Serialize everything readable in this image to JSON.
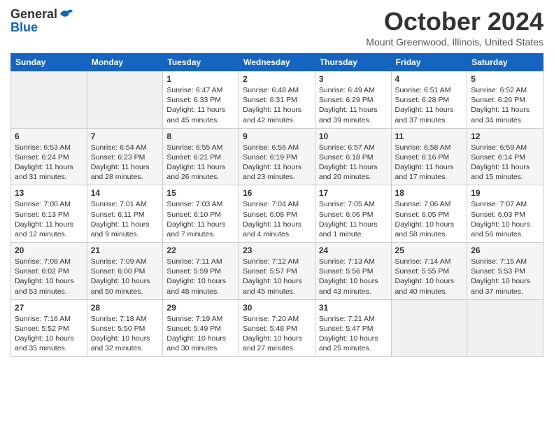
{
  "header": {
    "logo_general": "General",
    "logo_blue": "Blue",
    "title": "October 2024",
    "location": "Mount Greenwood, Illinois, United States"
  },
  "weekdays": [
    "Sunday",
    "Monday",
    "Tuesday",
    "Wednesday",
    "Thursday",
    "Friday",
    "Saturday"
  ],
  "weeks": [
    [
      {
        "day": "",
        "sunrise": "",
        "sunset": "",
        "daylight": ""
      },
      {
        "day": "",
        "sunrise": "",
        "sunset": "",
        "daylight": ""
      },
      {
        "day": "1",
        "sunrise": "Sunrise: 6:47 AM",
        "sunset": "Sunset: 6:33 PM",
        "daylight": "Daylight: 11 hours and 45 minutes."
      },
      {
        "day": "2",
        "sunrise": "Sunrise: 6:48 AM",
        "sunset": "Sunset: 6:31 PM",
        "daylight": "Daylight: 11 hours and 42 minutes."
      },
      {
        "day": "3",
        "sunrise": "Sunrise: 6:49 AM",
        "sunset": "Sunset: 6:29 PM",
        "daylight": "Daylight: 11 hours and 39 minutes."
      },
      {
        "day": "4",
        "sunrise": "Sunrise: 6:51 AM",
        "sunset": "Sunset: 6:28 PM",
        "daylight": "Daylight: 11 hours and 37 minutes."
      },
      {
        "day": "5",
        "sunrise": "Sunrise: 6:52 AM",
        "sunset": "Sunset: 6:26 PM",
        "daylight": "Daylight: 11 hours and 34 minutes."
      }
    ],
    [
      {
        "day": "6",
        "sunrise": "Sunrise: 6:53 AM",
        "sunset": "Sunset: 6:24 PM",
        "daylight": "Daylight: 11 hours and 31 minutes."
      },
      {
        "day": "7",
        "sunrise": "Sunrise: 6:54 AM",
        "sunset": "Sunset: 6:23 PM",
        "daylight": "Daylight: 11 hours and 28 minutes."
      },
      {
        "day": "8",
        "sunrise": "Sunrise: 6:55 AM",
        "sunset": "Sunset: 6:21 PM",
        "daylight": "Daylight: 11 hours and 26 minutes."
      },
      {
        "day": "9",
        "sunrise": "Sunrise: 6:56 AM",
        "sunset": "Sunset: 6:19 PM",
        "daylight": "Daylight: 11 hours and 23 minutes."
      },
      {
        "day": "10",
        "sunrise": "Sunrise: 6:57 AM",
        "sunset": "Sunset: 6:18 PM",
        "daylight": "Daylight: 11 hours and 20 minutes."
      },
      {
        "day": "11",
        "sunrise": "Sunrise: 6:58 AM",
        "sunset": "Sunset: 6:16 PM",
        "daylight": "Daylight: 11 hours and 17 minutes."
      },
      {
        "day": "12",
        "sunrise": "Sunrise: 6:59 AM",
        "sunset": "Sunset: 6:14 PM",
        "daylight": "Daylight: 11 hours and 15 minutes."
      }
    ],
    [
      {
        "day": "13",
        "sunrise": "Sunrise: 7:00 AM",
        "sunset": "Sunset: 6:13 PM",
        "daylight": "Daylight: 11 hours and 12 minutes."
      },
      {
        "day": "14",
        "sunrise": "Sunrise: 7:01 AM",
        "sunset": "Sunset: 6:11 PM",
        "daylight": "Daylight: 11 hours and 9 minutes."
      },
      {
        "day": "15",
        "sunrise": "Sunrise: 7:03 AM",
        "sunset": "Sunset: 6:10 PM",
        "daylight": "Daylight: 11 hours and 7 minutes."
      },
      {
        "day": "16",
        "sunrise": "Sunrise: 7:04 AM",
        "sunset": "Sunset: 6:08 PM",
        "daylight": "Daylight: 11 hours and 4 minutes."
      },
      {
        "day": "17",
        "sunrise": "Sunrise: 7:05 AM",
        "sunset": "Sunset: 6:06 PM",
        "daylight": "Daylight: 11 hours and 1 minute."
      },
      {
        "day": "18",
        "sunrise": "Sunrise: 7:06 AM",
        "sunset": "Sunset: 6:05 PM",
        "daylight": "Daylight: 10 hours and 58 minutes."
      },
      {
        "day": "19",
        "sunrise": "Sunrise: 7:07 AM",
        "sunset": "Sunset: 6:03 PM",
        "daylight": "Daylight: 10 hours and 56 minutes."
      }
    ],
    [
      {
        "day": "20",
        "sunrise": "Sunrise: 7:08 AM",
        "sunset": "Sunset: 6:02 PM",
        "daylight": "Daylight: 10 hours and 53 minutes."
      },
      {
        "day": "21",
        "sunrise": "Sunrise: 7:09 AM",
        "sunset": "Sunset: 6:00 PM",
        "daylight": "Daylight: 10 hours and 50 minutes."
      },
      {
        "day": "22",
        "sunrise": "Sunrise: 7:11 AM",
        "sunset": "Sunset: 5:59 PM",
        "daylight": "Daylight: 10 hours and 48 minutes."
      },
      {
        "day": "23",
        "sunrise": "Sunrise: 7:12 AM",
        "sunset": "Sunset: 5:57 PM",
        "daylight": "Daylight: 10 hours and 45 minutes."
      },
      {
        "day": "24",
        "sunrise": "Sunrise: 7:13 AM",
        "sunset": "Sunset: 5:56 PM",
        "daylight": "Daylight: 10 hours and 43 minutes."
      },
      {
        "day": "25",
        "sunrise": "Sunrise: 7:14 AM",
        "sunset": "Sunset: 5:55 PM",
        "daylight": "Daylight: 10 hours and 40 minutes."
      },
      {
        "day": "26",
        "sunrise": "Sunrise: 7:15 AM",
        "sunset": "Sunset: 5:53 PM",
        "daylight": "Daylight: 10 hours and 37 minutes."
      }
    ],
    [
      {
        "day": "27",
        "sunrise": "Sunrise: 7:16 AM",
        "sunset": "Sunset: 5:52 PM",
        "daylight": "Daylight: 10 hours and 35 minutes."
      },
      {
        "day": "28",
        "sunrise": "Sunrise: 7:18 AM",
        "sunset": "Sunset: 5:50 PM",
        "daylight": "Daylight: 10 hours and 32 minutes."
      },
      {
        "day": "29",
        "sunrise": "Sunrise: 7:19 AM",
        "sunset": "Sunset: 5:49 PM",
        "daylight": "Daylight: 10 hours and 30 minutes."
      },
      {
        "day": "30",
        "sunrise": "Sunrise: 7:20 AM",
        "sunset": "Sunset: 5:48 PM",
        "daylight": "Daylight: 10 hours and 27 minutes."
      },
      {
        "day": "31",
        "sunrise": "Sunrise: 7:21 AM",
        "sunset": "Sunset: 5:47 PM",
        "daylight": "Daylight: 10 hours and 25 minutes."
      },
      {
        "day": "",
        "sunrise": "",
        "sunset": "",
        "daylight": ""
      },
      {
        "day": "",
        "sunrise": "",
        "sunset": "",
        "daylight": ""
      }
    ]
  ]
}
